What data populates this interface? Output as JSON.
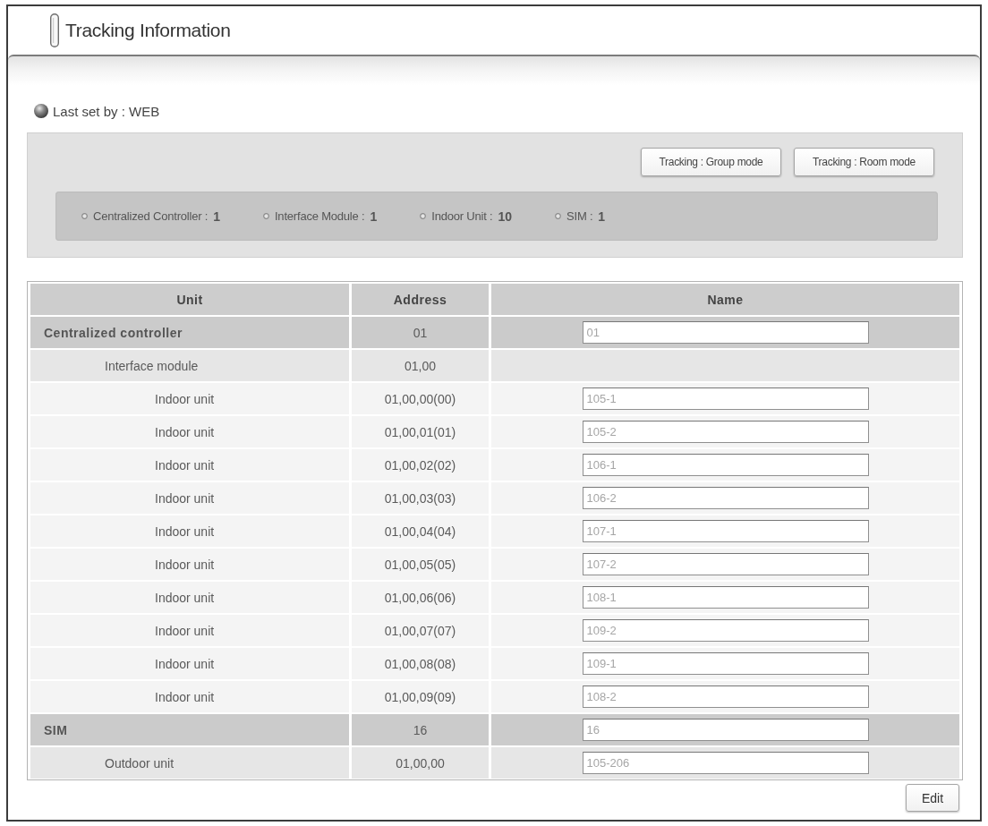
{
  "page": {
    "title": "Tracking Information"
  },
  "last_set": {
    "text": "Last set by : WEB"
  },
  "mode_buttons": [
    "Tracking : Group mode",
    "Tracking : Room mode"
  ],
  "summary": [
    {
      "label": "Centralized Controller :",
      "count": "1"
    },
    {
      "label": "Interface Module :",
      "count": "1"
    },
    {
      "label": "Indoor Unit :",
      "count": "10"
    },
    {
      "label": "SIM :",
      "count": "1"
    }
  ],
  "table": {
    "columns": [
      "Unit",
      "Address",
      "Name"
    ],
    "rows": [
      {
        "unit": "Centralized controller",
        "address": "01",
        "name_field": {
          "value": "01",
          "disabled": true
        },
        "children": [
          {
            "unit": "Interface module",
            "address": "01,00",
            "children": [
              {
                "unit": "Indoor unit",
                "address": "01,00,00(00)",
                "name_field": {
                  "value": "105-1",
                  "disabled": true
                }
              },
              {
                "unit": "Indoor unit",
                "address": "01,00,01(01)",
                "name_field": {
                  "value": "105-2",
                  "disabled": true
                }
              },
              {
                "unit": "Indoor unit",
                "address": "01,00,02(02)",
                "name_field": {
                  "value": "106-1",
                  "disabled": true
                }
              },
              {
                "unit": "Indoor unit",
                "address": "01,00,03(03)",
                "name_field": {
                  "value": "106-2",
                  "disabled": true
                }
              },
              {
                "unit": "Indoor unit",
                "address": "01,00,04(04)",
                "name_field": {
                  "value": "107-1",
                  "disabled": true
                }
              },
              {
                "unit": "Indoor unit",
                "address": "01,00,05(05)",
                "name_field": {
                  "value": "107-2",
                  "disabled": true
                }
              },
              {
                "unit": "Indoor unit",
                "address": "01,00,06(06)",
                "name_field": {
                  "value": "108-1",
                  "disabled": true
                }
              },
              {
                "unit": "Indoor unit",
                "address": "01,00,07(07)",
                "name_field": {
                  "value": "109-2",
                  "disabled": true
                }
              },
              {
                "unit": "Indoor unit",
                "address": "01,00,08(08)",
                "name_field": {
                  "value": "109-1",
                  "disabled": true
                }
              },
              {
                "unit": "Indoor unit",
                "address": "01,00,09(09)",
                "name_field": {
                  "value": "108-2",
                  "disabled": true
                }
              }
            ]
          }
        ]
      },
      {
        "unit": "SIM",
        "address": "16",
        "name_field": {
          "value": "16",
          "disabled": true
        },
        "children": [
          {
            "unit": "Outdoor unit",
            "address": "01,00,00",
            "name_field": {
              "value": "105-206",
              "disabled": true
            }
          }
        ]
      }
    ]
  },
  "edit_button": {
    "label": "Edit"
  }
}
